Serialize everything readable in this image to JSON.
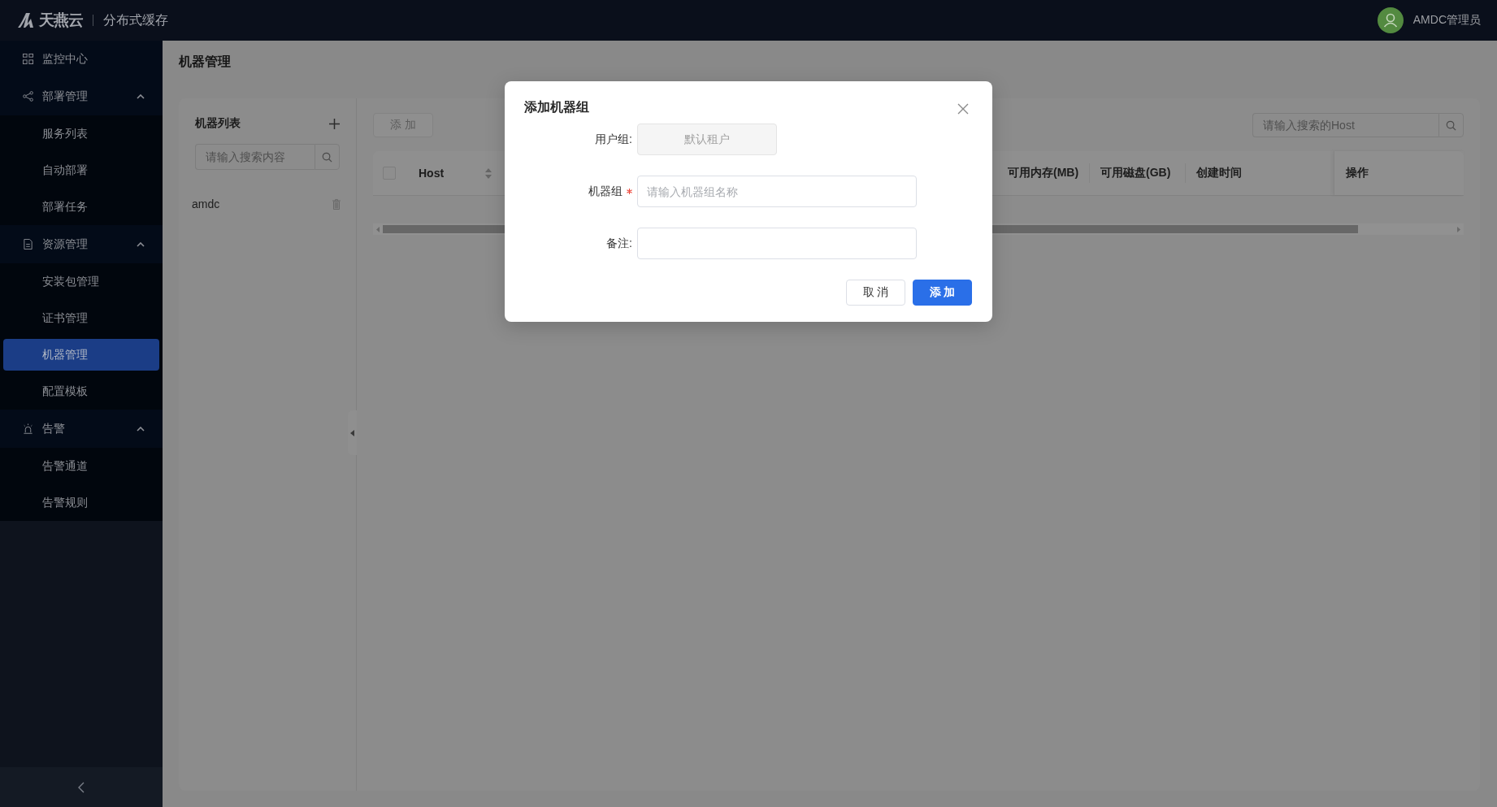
{
  "header": {
    "brand": "天燕云",
    "product": "分布式缓存",
    "user": "AMDC管理员"
  },
  "sidebar": {
    "items": [
      {
        "kind": "link",
        "label": "监控中心",
        "selected": false
      },
      {
        "kind": "group",
        "label": "部署管理",
        "selected": false,
        "expanded": true,
        "children": [
          {
            "label": "服务列表",
            "selected": false
          },
          {
            "label": "自动部署",
            "selected": false
          },
          {
            "label": "部署任务",
            "selected": false
          }
        ]
      },
      {
        "kind": "group",
        "label": "资源管理",
        "selected": false,
        "expanded": true,
        "children": [
          {
            "label": "安装包管理",
            "selected": false
          },
          {
            "label": "证书管理",
            "selected": false
          },
          {
            "label": "机器管理",
            "selected": true
          },
          {
            "label": "配置模板",
            "selected": false
          }
        ]
      },
      {
        "kind": "group",
        "label": "告警",
        "selected": false,
        "expanded": true,
        "children": [
          {
            "label": "告警通道",
            "selected": false
          },
          {
            "label": "告警规则",
            "selected": false
          }
        ]
      }
    ]
  },
  "page": {
    "title": "机器管理"
  },
  "machine_list": {
    "title": "机器列表",
    "search": {
      "placeholder": "请输入搜索内容"
    },
    "items": [
      {
        "label": "amdc",
        "selected": false
      }
    ]
  },
  "toolbar": {
    "add_button": {
      "label": "添 加",
      "disabled": true
    },
    "search": {
      "placeholder": "请输入搜索的Host"
    }
  },
  "table": {
    "select_all": {
      "checked": false
    },
    "columns": [
      {
        "label": "Host",
        "sortable": true
      },
      {
        "label": "可用内存(MB)",
        "sortable": false
      },
      {
        "label": "可用磁盘(GB)",
        "sortable": false
      },
      {
        "label": "创建时间",
        "sortable": false
      },
      {
        "label": "操作",
        "sortable": false
      }
    ]
  },
  "dialog": {
    "title": "添加机器组",
    "fields": [
      {
        "label": "用户组:",
        "value": "默认租户",
        "disabled": true,
        "required": false
      },
      {
        "label": "机器组",
        "placeholder": "请输入机器组名称",
        "disabled": false,
        "required": true
      },
      {
        "label": "备注:",
        "disabled": false,
        "required": false
      }
    ],
    "buttons": [
      {
        "label": "取 消",
        "kind": "secondary"
      },
      {
        "label": "添 加",
        "kind": "primary"
      }
    ]
  }
}
